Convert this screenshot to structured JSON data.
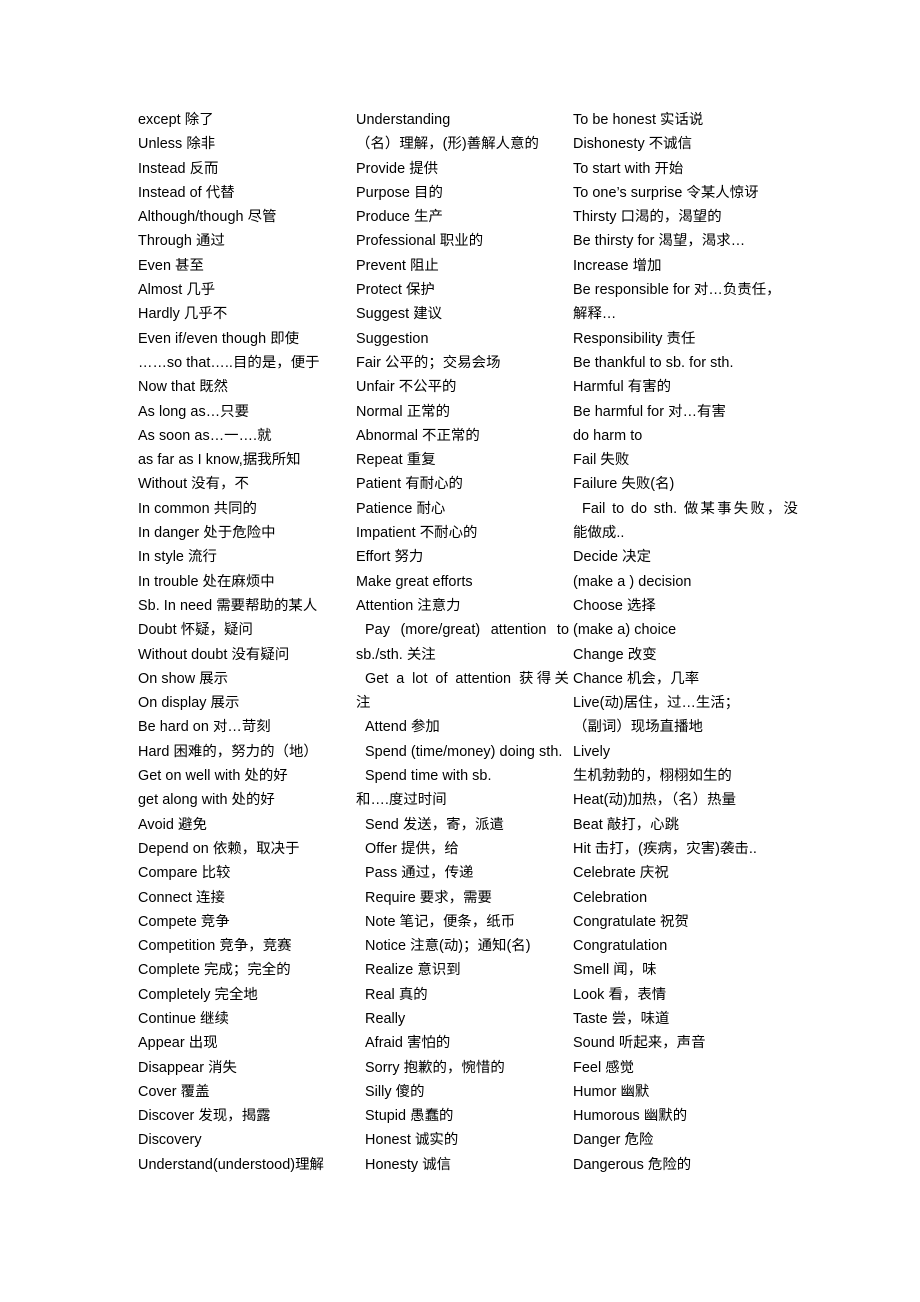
{
  "document": {
    "type": "vocabulary-list",
    "title": "",
    "language_pair": "English-Chinese",
    "columns": [
      {
        "id": "column-1",
        "lines": [
          {
            "text": "except 除了",
            "style": "plain"
          },
          {
            "text": "Unless 除非",
            "style": "plain"
          },
          {
            "text": "Instead 反而",
            "style": "plain"
          },
          {
            "text": "Instead of 代替",
            "style": "plain"
          },
          {
            "text": "Although/though 尽管",
            "style": "plain"
          },
          {
            "text": "Through 通过",
            "style": "plain"
          },
          {
            "text": "Even 甚至",
            "style": "plain"
          },
          {
            "text": "Almost 几乎",
            "style": "plain"
          },
          {
            "text": "Hardly 几乎不",
            "style": "plain"
          },
          {
            "text": "Even if/even though 即使",
            "style": "plain"
          },
          {
            "text": "……so that…..目的是，便于",
            "style": "plain"
          },
          {
            "text": "Now that 既然",
            "style": "plain"
          },
          {
            "text": "As long as…只要",
            "style": "plain"
          },
          {
            "text": "As soon as…一….就",
            "style": "plain"
          },
          {
            "text": "as far as I know,据我所知",
            "style": "plain"
          },
          {
            "text": "Without 没有，不",
            "style": "plain"
          },
          {
            "text": "In common 共同的",
            "style": "plain"
          },
          {
            "text": "In danger 处于危险中",
            "style": "plain"
          },
          {
            "text": "In style 流行",
            "style": "plain"
          },
          {
            "text": "In trouble 处在麻烦中",
            "style": "plain"
          },
          {
            "text": "Sb. In need 需要帮助的某人",
            "style": "plain"
          },
          {
            "text": "Doubt 怀疑，疑问",
            "style": "plain"
          },
          {
            "text": "Without doubt 没有疑问",
            "style": "plain"
          },
          {
            "text": "On show 展示",
            "style": "plain"
          },
          {
            "text": "On display 展示",
            "style": "plain"
          },
          {
            "text": "Be hard on 对…苛刻",
            "style": "plain"
          },
          {
            "text": "Hard 困难的，努力的（地）",
            "style": "plain"
          },
          {
            "text": "Get on well with 处的好",
            "style": "plain"
          },
          {
            "text": "get along with 处的好",
            "style": "plain"
          },
          {
            "text": "Avoid 避免",
            "style": "plain"
          },
          {
            "text": "Depend on 依赖，取决于",
            "style": "plain"
          },
          {
            "text": "Compare 比较",
            "style": "plain"
          },
          {
            "text": "Connect 连接",
            "style": "plain"
          },
          {
            "text": "Compete 竞争",
            "style": "plain"
          },
          {
            "text": "Competition 竞争，竞赛",
            "style": "plain"
          },
          {
            "text": "Complete 完成；完全的",
            "style": "plain"
          },
          {
            "text": "Completely 完全地",
            "style": "plain"
          },
          {
            "text": "Continue 继续",
            "style": "plain"
          },
          {
            "text": "Appear 出现",
            "style": "plain"
          },
          {
            "text": "Disappear 消失",
            "style": "plain"
          },
          {
            "text": "Cover 覆盖",
            "style": "plain"
          },
          {
            "text": "Discover 发现，揭露",
            "style": "plain"
          },
          {
            "text": "Discovery",
            "style": "plain"
          },
          {
            "text": "Understand(understood)理解",
            "style": "plain"
          }
        ]
      },
      {
        "id": "column-2",
        "lines": [
          {
            "text": "Understanding",
            "style": "plain"
          },
          {
            "text": "（名）理解，(形)善解人意的",
            "style": "wrap-cont"
          },
          {
            "text": "Provide 提供",
            "style": "plain"
          },
          {
            "text": "Purpose 目的",
            "style": "plain"
          },
          {
            "text": "Produce 生产",
            "style": "plain"
          },
          {
            "text": "Professional 职业的",
            "style": "plain"
          },
          {
            "text": "Prevent 阻止",
            "style": "plain"
          },
          {
            "text": "Protect 保护",
            "style": "plain"
          },
          {
            "text": "Suggest 建议",
            "style": "plain"
          },
          {
            "text": "Suggestion",
            "style": "plain"
          },
          {
            "text": "Fair 公平的；交易会场",
            "style": "plain"
          },
          {
            "text": "Unfair 不公平的",
            "style": "plain"
          },
          {
            "text": "Normal 正常的",
            "style": "plain"
          },
          {
            "text": "Abnormal 不正常的",
            "style": "plain"
          },
          {
            "text": "Repeat 重复",
            "style": "plain"
          },
          {
            "text": "Patient 有耐心的",
            "style": "plain"
          },
          {
            "text": "Patience 耐心",
            "style": "plain"
          },
          {
            "text": "Impatient 不耐心的",
            "style": "plain"
          },
          {
            "text": "Effort 努力",
            "style": "plain"
          },
          {
            "text": "Make great efforts",
            "style": "plain"
          },
          {
            "text": "Attention 注意力",
            "style": "plain"
          },
          {
            "text": "Pay (more/great) attention to",
            "style": "just"
          },
          {
            "text": "sb./sth. 关注",
            "style": "just-cont"
          },
          {
            "text": "Get a lot of attention 获得关",
            "style": "just"
          },
          {
            "text": "注",
            "style": "just-cont"
          },
          {
            "text": "Attend 参加",
            "style": "indent"
          },
          {
            "text": "Spend (time/money) doing sth.",
            "style": "indent"
          },
          {
            "text": "Spend time with sb.",
            "style": "indent"
          },
          {
            "text": "和….度过时间",
            "style": "wrap-cont"
          },
          {
            "text": "Send 发送，寄，派遣",
            "style": "indent"
          },
          {
            "text": "Offer 提供，给",
            "style": "indent"
          },
          {
            "text": "Pass 通过，传递",
            "style": "indent"
          },
          {
            "text": "Require 要求，需要",
            "style": "indent"
          },
          {
            "text": "Note 笔记，便条，纸币",
            "style": "indent"
          },
          {
            "text": "Notice 注意(动)；通知(名)",
            "style": "indent"
          },
          {
            "text": "Realize 意识到",
            "style": "indent"
          },
          {
            "text": "Real 真的",
            "style": "indent"
          },
          {
            "text": "Really",
            "style": "indent"
          },
          {
            "text": "Afraid 害怕的",
            "style": "indent"
          },
          {
            "text": "Sorry 抱歉的，惋惜的",
            "style": "indent"
          },
          {
            "text": "Silly 傻的",
            "style": "indent"
          },
          {
            "text": "Stupid 愚蠢的",
            "style": "indent"
          },
          {
            "text": "Honest 诚实的",
            "style": "indent"
          },
          {
            "text": "Honesty 诚信",
            "style": "indent"
          }
        ]
      },
      {
        "id": "column-3",
        "lines": [
          {
            "text": "To be honest 实话说",
            "style": "plain"
          },
          {
            "text": "Dishonesty 不诚信",
            "style": "plain"
          },
          {
            "text": "To start with 开始",
            "style": "plain"
          },
          {
            "text": "To one’s surprise 令某人惊讶",
            "style": "plain"
          },
          {
            "text": "Thirsty 口渴的，渴望的",
            "style": "plain"
          },
          {
            "text": "Be thirsty for 渴望，渴求…",
            "style": "plain"
          },
          {
            "text": "Increase 增加",
            "style": "plain"
          },
          {
            "text": "Be responsible for 对…负责任，",
            "style": "plain"
          },
          {
            "text": "解释…",
            "style": "wrap-cont"
          },
          {
            "text": "Responsibility 责任",
            "style": "plain"
          },
          {
            "text": "Be thankful to sb. for sth.",
            "style": "plain"
          },
          {
            "text": "Harmful 有害的",
            "style": "plain"
          },
          {
            "text": "Be harmful for 对…有害",
            "style": "plain"
          },
          {
            "text": "do harm to",
            "style": "plain"
          },
          {
            "text": "Fail 失败",
            "style": "plain"
          },
          {
            "text": "Failure 失败(名)",
            "style": "plain"
          },
          {
            "text": "Fail to do sth. 做某事失败，没",
            "style": "just"
          },
          {
            "text": "能做成..",
            "style": "just-cont"
          },
          {
            "text": "Decide 决定",
            "style": "plain"
          },
          {
            "text": "(make a ) decision",
            "style": "plain"
          },
          {
            "text": "Choose 选择",
            "style": "plain"
          },
          {
            "text": "(make a) choice",
            "style": "plain"
          },
          {
            "text": "Change 改变",
            "style": "plain"
          },
          {
            "text": "Chance 机会，几率",
            "style": "plain"
          },
          {
            "text": "Live(动)居住，过…生活；",
            "style": "plain"
          },
          {
            "text": "（副词）现场直播地",
            "style": "wrap-cont"
          },
          {
            "text": "Lively",
            "style": "plain"
          },
          {
            "text": "生机勃勃的，栩栩如生的",
            "style": "wrap-cont"
          },
          {
            "text": "Heat(动)加热，（名）热量",
            "style": "plain"
          },
          {
            "text": "Beat 敲打，心跳",
            "style": "plain"
          },
          {
            "text": "Hit 击打，(疾病，灾害)袭击..",
            "style": "plain"
          },
          {
            "text": "Celebrate 庆祝",
            "style": "plain"
          },
          {
            "text": "Celebration",
            "style": "plain"
          },
          {
            "text": "Congratulate 祝贺",
            "style": "plain"
          },
          {
            "text": "Congratulation",
            "style": "plain"
          },
          {
            "text": "Smell 闻，味",
            "style": "plain"
          },
          {
            "text": "Look 看，表情",
            "style": "plain"
          },
          {
            "text": "Taste 尝，味道",
            "style": "plain"
          },
          {
            "text": "Sound 听起来，声音",
            "style": "plain"
          },
          {
            "text": "Feel 感觉",
            "style": "plain"
          },
          {
            "text": "Humor 幽默",
            "style": "plain"
          },
          {
            "text": "Humorous 幽默的",
            "style": "plain"
          },
          {
            "text": "Danger 危险",
            "style": "plain"
          },
          {
            "text": "Dangerous 危险的",
            "style": "plain"
          }
        ]
      }
    ]
  }
}
